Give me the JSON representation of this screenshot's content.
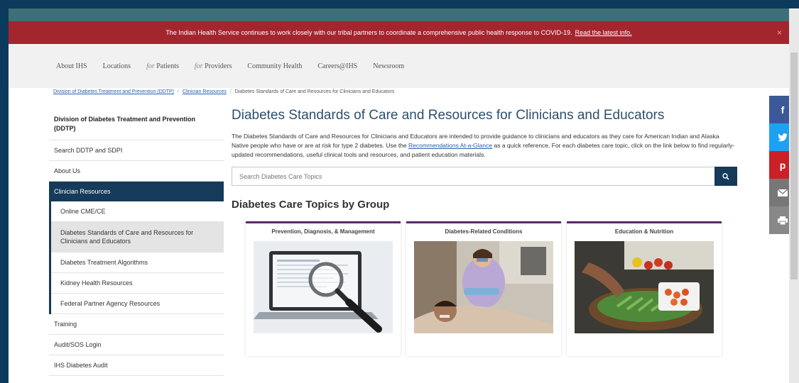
{
  "alert": {
    "text": "The Indian Health Service continues to work closely with our tribal partners to coordinate a comprehensive public health response to COVID-19.",
    "link": "Read the latest info.",
    "close": "×"
  },
  "nav": {
    "items": [
      {
        "label": "About IHS"
      },
      {
        "label": "Locations"
      },
      {
        "prefix": "for",
        "label": " Patients"
      },
      {
        "prefix": "for",
        "label": " Providers"
      },
      {
        "label": "Community Health"
      },
      {
        "label": "Careers@IHS"
      },
      {
        "label": "Newsroom"
      }
    ]
  },
  "breadcrumb": {
    "items": [
      "Division of Diabetes Treatment and Prevention (DDTP)",
      "Clinician Resources",
      "Diabetes Standards of Care and Resources for Clinicians and Educators"
    ],
    "separator": "/"
  },
  "sidebar": {
    "heading": "Division of Diabetes Treatment and Prevention (DDTP)",
    "items": [
      "Search DDTP and SDPI",
      "About Us",
      "Clinician Resources"
    ],
    "subitems": [
      "Online CME/CE",
      "Diabetes Standards of Care and Resources for Clinicians and Educators",
      "Diabetes Treatment Algorithms",
      "Kidney Health Resources",
      "Federal Partner Agency Resources"
    ],
    "after": [
      "Training",
      "Audit/SOS Login",
      "IHS Diabetes Audit"
    ]
  },
  "main": {
    "title": "Diabetes Standards of Care and Resources for Clinicians and Educators",
    "intro_before": "The Diabetes Standards of Care and Resources for Clinicians and Educators are intended to provide guidance to clinicians and educators as they care for American Indian and Alaska Native people who have or are at risk for type 2 diabetes. Use the ",
    "intro_link": "Recommendations At-a-Glance",
    "intro_after": " as a quick reference. For each diabetes care topic, click on the link below to find regularly-updated recommendations, useful clinical tools and resources, and patient education materials.",
    "search_placeholder": "Search Diabetes Care Topics",
    "group_title": "Diabetes Care Topics by Group",
    "cards": [
      {
        "title": "Prevention, Diagnosis, & Management"
      },
      {
        "title": "Diabetes-Related Conditions"
      },
      {
        "title": "Education & Nutrition"
      }
    ]
  },
  "social": {
    "facebook": "f",
    "twitter": "t",
    "pinterest": "p",
    "colors": {
      "facebook": "#3b5998",
      "twitter": "#1da1f2",
      "pinterest": "#cb2027",
      "email": "#777777",
      "print": "#888888"
    }
  },
  "colors": {
    "alert": "#a3262f",
    "nav_active": "#153a5a",
    "card_border": "#5b2a6a",
    "title": "#2d4f6e"
  }
}
